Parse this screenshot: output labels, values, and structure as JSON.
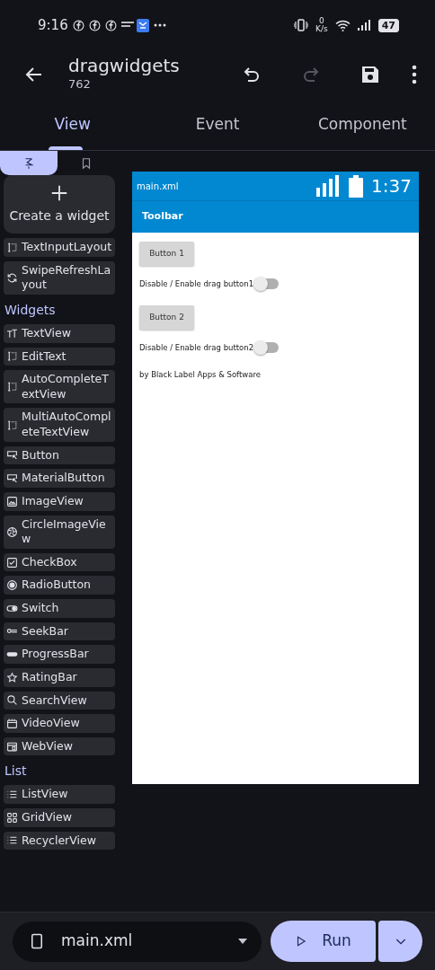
{
  "status_bar": {
    "time": "9:16",
    "net_speed_value": "0",
    "net_speed_unit": "K/s",
    "battery": "47"
  },
  "app_bar": {
    "title": "dragwidgets",
    "subtitle": "762",
    "redo_disabled": true
  },
  "tabs": [
    {
      "label": "View",
      "selected": true
    },
    {
      "label": "Event",
      "selected": false
    },
    {
      "label": "Component",
      "selected": false
    }
  ],
  "palette_tabs": [
    {
      "kind": "widgets",
      "selected": true
    },
    {
      "kind": "bookmarks",
      "selected": false
    }
  ],
  "create_widget": {
    "label": "Create a widget"
  },
  "sections": [
    {
      "items": [
        {
          "label": "TextInputLayout",
          "kind": "input"
        },
        {
          "label": "SwipeRefreshLayout",
          "kind": "refresh"
        }
      ]
    },
    {
      "title": "Widgets",
      "items": [
        {
          "label": "TextView",
          "kind": "text"
        },
        {
          "label": "EditText",
          "kind": "input"
        },
        {
          "label": "AutoCompleteTextView",
          "kind": "input"
        },
        {
          "label": "MultiAutoCompleteTextView",
          "kind": "input"
        },
        {
          "label": "Button",
          "kind": "button"
        },
        {
          "label": "MaterialButton",
          "kind": "button"
        },
        {
          "label": "ImageView",
          "kind": "image"
        },
        {
          "label": "CircleImageView",
          "kind": "aperture"
        },
        {
          "label": "CheckBox",
          "kind": "checkbox"
        },
        {
          "label": "RadioButton",
          "kind": "radio"
        },
        {
          "label": "Switch",
          "kind": "switch"
        },
        {
          "label": "SeekBar",
          "kind": "seek"
        },
        {
          "label": "ProgressBar",
          "kind": "progress"
        },
        {
          "label": "RatingBar",
          "kind": "star"
        },
        {
          "label": "SearchView",
          "kind": "search"
        },
        {
          "label": "VideoView",
          "kind": "video"
        },
        {
          "label": "WebView",
          "kind": "web"
        }
      ]
    },
    {
      "title": "List",
      "items": [
        {
          "label": "ListView",
          "kind": "list"
        },
        {
          "label": "GridView",
          "kind": "grid"
        },
        {
          "label": "RecyclerView",
          "kind": "list"
        }
      ]
    }
  ],
  "preview": {
    "file": "main.xml",
    "clock": "1:37",
    "toolbar": "Toolbar",
    "views": [
      {
        "kind": "button",
        "text": "Button 1"
      },
      {
        "kind": "switch",
        "text": "Disable / Enable drag button1",
        "on": false
      },
      {
        "kind": "button",
        "text": "Button 2"
      },
      {
        "kind": "switch",
        "text": "Disable / Enable drag button2",
        "on": false
      },
      {
        "kind": "text",
        "text": "by Black Label Apps & Software"
      }
    ]
  },
  "bottom": {
    "file": "main.xml",
    "run": "Run"
  }
}
